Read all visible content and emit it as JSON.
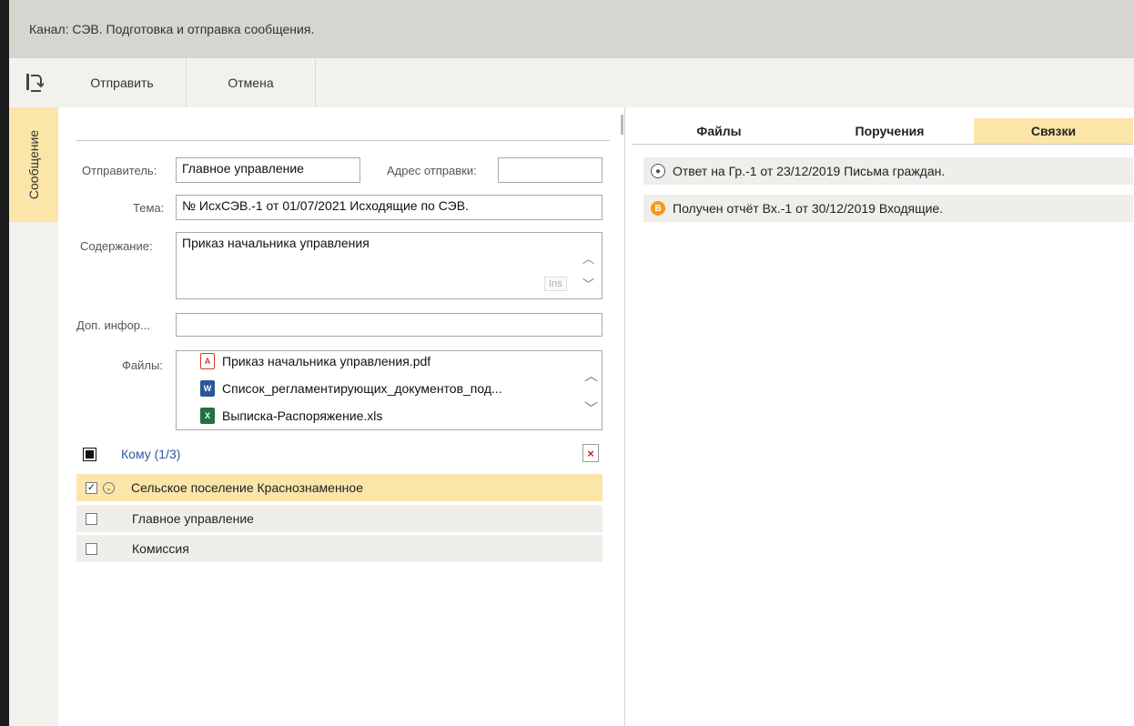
{
  "window": {
    "title": "Канал: СЭВ. Подготовка и отправка сообщения."
  },
  "toolbar": {
    "icon": "return-icon",
    "send_label": "Отправить",
    "cancel_label": "Отмена"
  },
  "side_tabs": {
    "message_label": "Сообщение"
  },
  "form": {
    "sender_label": "Отправитель:",
    "sender_value": "Главное управление",
    "address_label": "Адрес отправки:",
    "address_value": "",
    "subject_label": "Тема:",
    "subject_value": "№ ИсхСЭВ.-1 от 01/07/2021 Исходящие по СЭВ.",
    "content_label": "Содержание:",
    "content_value": "Приказ начальника управления",
    "content_ins_badge": "Ins",
    "extra_label": "Доп. инфор...",
    "extra_value": "",
    "files_label": "Файлы:",
    "files": [
      {
        "name": "Приказ начальника управления.pdf",
        "icon": "pdf-file-icon"
      },
      {
        "name": "Список_регламентирующих_документов_под...",
        "icon": "word-file-icon"
      },
      {
        "name": "Выписка-Распоряжение.xls",
        "icon": "excel-file-icon"
      }
    ]
  },
  "recipients": {
    "header_label": "Кому (1/3)",
    "items": [
      {
        "name": "Сельское поселение Краснознаменное",
        "checked": true,
        "selected": true
      },
      {
        "name": "Главное управление",
        "checked": false,
        "selected": false
      },
      {
        "name": "Комиссия",
        "checked": false,
        "selected": false
      }
    ]
  },
  "right_panel": {
    "tabs": [
      {
        "label": "Файлы",
        "active": false
      },
      {
        "label": "Поручения",
        "active": false
      },
      {
        "label": "Связки",
        "active": true
      }
    ],
    "links": [
      {
        "text": "Ответ на Гр.-1 от 23/12/2019 Письма граждан.",
        "icon": "person-circle-icon"
      },
      {
        "text": "Получен отчёт Вх.-1 от 30/12/2019 Входящие.",
        "icon": "orange-b-circle-icon"
      }
    ]
  },
  "colors": {
    "accent_yellow": "#fce5a9",
    "titlebar_bg": "#d7d5cf",
    "toolbar_bg": "#f2f1ee",
    "row_bg": "#efeeea",
    "link_blue": "#2e5a9e"
  }
}
